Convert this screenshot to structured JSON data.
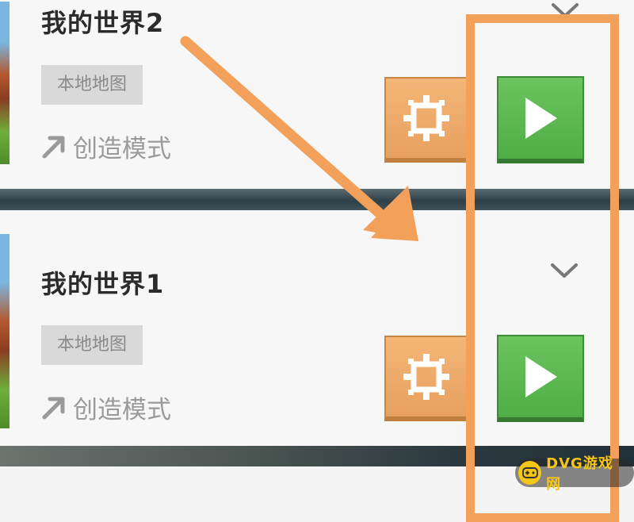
{
  "worlds": [
    {
      "title": "我的世界2",
      "tag": "本地地图",
      "mode": "创造模式"
    },
    {
      "title": "我的世界1",
      "tag": "本地地图",
      "mode": "创造模式"
    }
  ],
  "icons": {
    "settings": "gear-icon",
    "play": "play-icon",
    "expand": "chevron-down-icon",
    "mode": "arrow-up-right-icon"
  },
  "colors": {
    "settings_button": "#e8a060",
    "play_button": "#4fae46",
    "annotation": "#f2a05a",
    "title_text": "#2b2b2b",
    "muted_text": "#9a9a9a"
  },
  "watermark": {
    "text": "DVG游戏网"
  }
}
